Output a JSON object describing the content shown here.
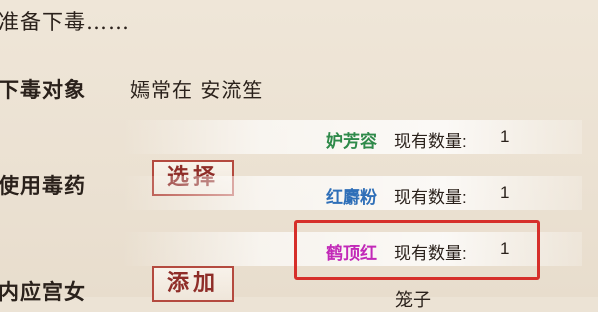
{
  "header": {
    "status": "准备下毒……"
  },
  "target": {
    "label": "下毒对象",
    "value": "嫣常在 安流笙"
  },
  "poison": {
    "label": "使用毒药",
    "button": "选择"
  },
  "maid": {
    "label": "内应宫女",
    "button": "添加"
  },
  "poison_list": [
    {
      "name": "妒芳容",
      "color": "#2f8a4a",
      "qty_label": "现有数量:",
      "qty": "1"
    },
    {
      "name": "红麝粉",
      "color": "#2f6fb8",
      "qty_label": "现有数量:",
      "qty": "1"
    },
    {
      "name": "鹤顶红",
      "color": "#c229b8",
      "qty_label": "现有数量:",
      "qty": "1"
    }
  ],
  "partial_item": "笼子",
  "colors": {
    "highlight": "#d62f2a",
    "button_text": "#8f2d28",
    "button_border": "#b44a3f"
  }
}
